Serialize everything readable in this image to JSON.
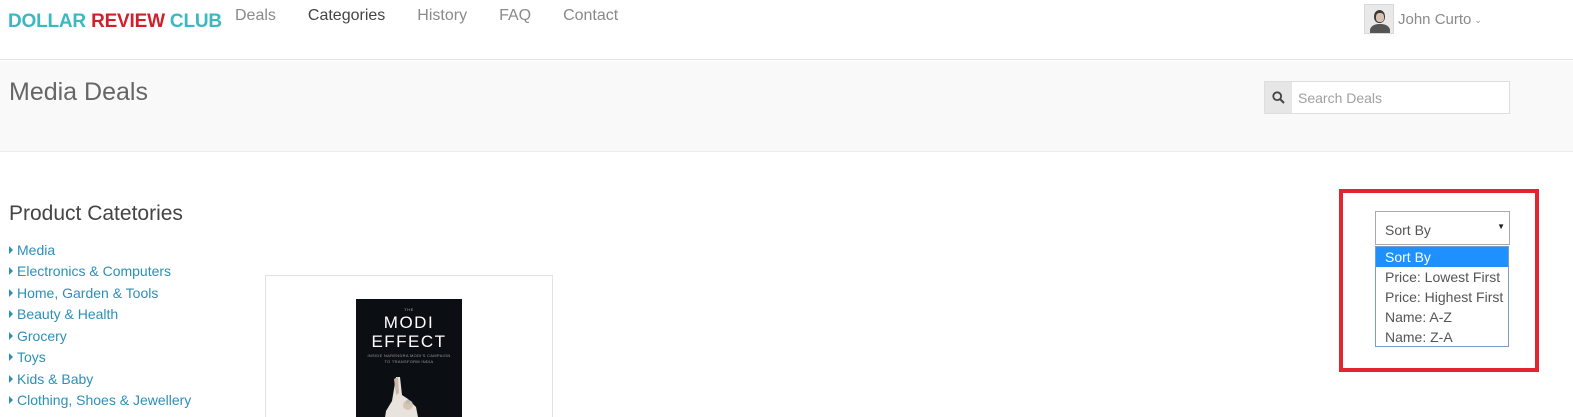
{
  "brand": {
    "part1": "DOLLAR",
    "part2": "REVIEW",
    "part3": "CLUB"
  },
  "nav": [
    {
      "label": "Deals",
      "active": false
    },
    {
      "label": "Categories",
      "active": true
    },
    {
      "label": "History",
      "active": false
    },
    {
      "label": "FAQ",
      "active": false
    },
    {
      "label": "Contact",
      "active": false
    }
  ],
  "user": {
    "name": "John Curto"
  },
  "page": {
    "title": "Media Deals"
  },
  "search": {
    "placeholder": "Search Deals",
    "icon": "search-icon"
  },
  "sidebar": {
    "title": "Product Catetories",
    "items": [
      "Media",
      "Electronics & Computers",
      "Home, Garden & Tools",
      "Beauty & Health",
      "Grocery",
      "Toys",
      "Kids & Baby",
      "Clothing, Shoes & Jewellery"
    ]
  },
  "product": {
    "cover_top": "THE",
    "cover_title_1": "MODI",
    "cover_title_2": "EFFECT",
    "cover_subtitle_1": "INSIDE NARENDRA MODI'S CAMPAIGN",
    "cover_subtitle_2": "TO TRANSFORM INDIA"
  },
  "sort": {
    "selected": "Sort By",
    "options": [
      "Sort By",
      "Price: Lowest First",
      "Price: Highest First",
      "Name: A-Z",
      "Name: Z-A"
    ]
  },
  "colors": {
    "brand_teal": "#3ab8c3",
    "brand_red": "#d0202a",
    "link_blue": "#2d8fb8",
    "highlight_red": "#e3252f",
    "option_selected": "#1e90ff"
  }
}
